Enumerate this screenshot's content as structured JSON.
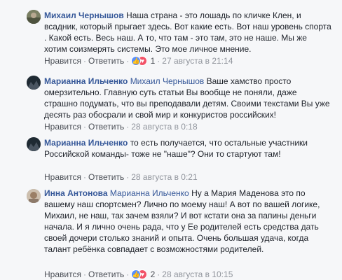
{
  "comments": [
    {
      "author": "Михаил Чернышов",
      "mention": "",
      "text": "Наша страна - это лошадь по кличке Клен, и всадник, который прыгает здесь. Вот какие есть. Вот наш уровень спорта . Какой есть. Весь наш. А то, что там - это там, это не наше. Мы же хотим соизмерять системы. Это мое личное мнение.",
      "reply_label": "Нравится",
      "answer_label": "Ответить",
      "reaction_count": "1",
      "time": "27 августа в 21:14",
      "avatar_color": "#6b6f5a"
    },
    {
      "author": "Марианна Ильченко",
      "mention": "Михаил Чернышов",
      "text": "Ваше хамство просто омерзительно. Главную суть статьи Вы вообще не поняли, даже страшно подумать, что вы преподавали детям. Своими текстами Вы уже десять раз обосрали и свой мир и конкуристов российских!",
      "reply_label": "Нравится",
      "answer_label": "Ответить",
      "reaction_count": "",
      "time": "28 августа в 0:18",
      "avatar_color": "#2f3a44"
    },
    {
      "author": "Марианна Ильченко",
      "mention": "",
      "text": "то есть получается, что остальные участники Российской команды- тоже не \"наше\"? Они то стартуют там!",
      "reply_label": "Нравится",
      "answer_label": "Ответить",
      "reaction_count": "",
      "time": "28 августа в 0:21",
      "avatar_color": "#2f3a44"
    },
    {
      "author": "Инна Антонова",
      "mention": "Марианна Ильченко",
      "text": "Ну а Мария Маденова это по вашему наш спортсмен? Лично по моему наш! А вот по вашей логике, Михаил, не наш, так зачем взяли? И вот кстати она за папины деньги начала. И я лично очень рада, что у Ее родителей есть средства дать своей дочери столько знаний и опыта. Очень большая удача, когда талант ребёнка совпадает с возможностями родителей.",
      "reply_label": "Нравится",
      "answer_label": "Ответить",
      "reaction_count": "2",
      "time": "28 августа в 10:15",
      "avatar_color": "#b8a898"
    }
  ],
  "reaction_icons": [
    "like-icon",
    "love-icon"
  ],
  "link_color": "#365899"
}
